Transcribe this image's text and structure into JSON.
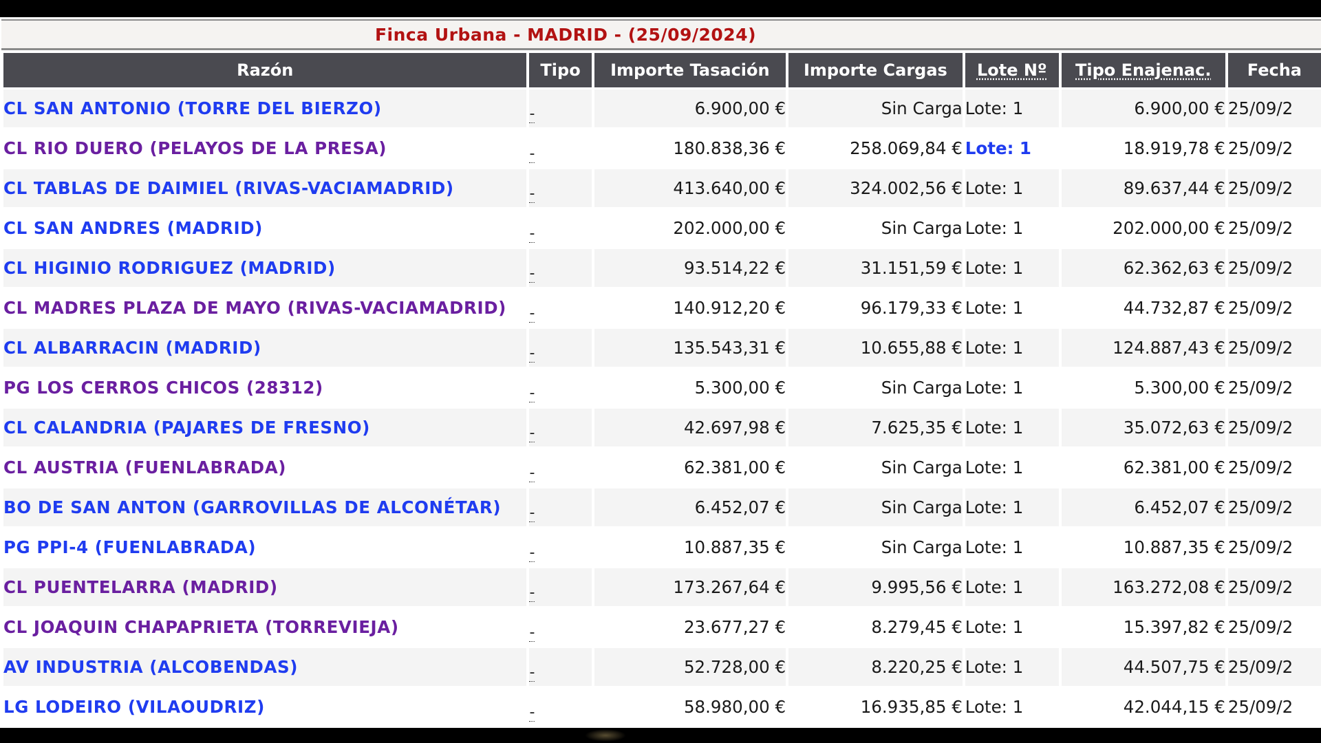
{
  "caption": "Finca Urbana - MADRID - (25/09/2024)",
  "headers": {
    "razon": "Razón",
    "tipo": "Tipo",
    "importe_tasacion": "Importe Tasación",
    "importe_cargas": "Importe Cargas",
    "lote": "Lote Nº",
    "tipo_enajenac": "Tipo Enajenac.",
    "fecha": "Fecha"
  },
  "rows": [
    {
      "razon": "CL SAN ANTONIO (TORRE DEL BIERZO)",
      "link_state": "unvisited",
      "tipo": "-",
      "tasacion": "6.900,00 €",
      "cargas": "Sin Carga",
      "lote": "Lote: 1",
      "lote_is_link": false,
      "enajenac": "6.900,00 €",
      "fecha": "25/09/2"
    },
    {
      "razon": "CL RIO DUERO (PELAYOS DE LA PRESA)",
      "link_state": "visited",
      "tipo": "-",
      "tasacion": "180.838,36 €",
      "cargas": "258.069,84 €",
      "lote": "Lote: 1",
      "lote_is_link": true,
      "enajenac": "18.919,78 €",
      "fecha": "25/09/2"
    },
    {
      "razon": "CL TABLAS DE DAIMIEL (RIVAS-VACIAMADRID)",
      "link_state": "unvisited",
      "tipo": "-",
      "tasacion": "413.640,00 €",
      "cargas": "324.002,56 €",
      "lote": "Lote: 1",
      "lote_is_link": false,
      "enajenac": "89.637,44 €",
      "fecha": "25/09/2"
    },
    {
      "razon": "CL SAN ANDRES (MADRID)",
      "link_state": "unvisited",
      "tipo": "-",
      "tasacion": "202.000,00 €",
      "cargas": "Sin Carga",
      "lote": "Lote: 1",
      "lote_is_link": false,
      "enajenac": "202.000,00 €",
      "fecha": "25/09/2"
    },
    {
      "razon": "CL HIGINIO RODRIGUEZ (MADRID)",
      "link_state": "unvisited",
      "tipo": "-",
      "tasacion": "93.514,22 €",
      "cargas": "31.151,59 €",
      "lote": "Lote: 1",
      "lote_is_link": false,
      "enajenac": "62.362,63 €",
      "fecha": "25/09/2"
    },
    {
      "razon": "CL MADRES PLAZA DE MAYO (RIVAS-VACIAMADRID)",
      "link_state": "visited",
      "tipo": "-",
      "tasacion": "140.912,20 €",
      "cargas": "96.179,33 €",
      "lote": "Lote: 1",
      "lote_is_link": false,
      "enajenac": "44.732,87 €",
      "fecha": "25/09/2"
    },
    {
      "razon": "CL ALBARRACIN (MADRID)",
      "link_state": "unvisited",
      "tipo": "-",
      "tasacion": "135.543,31 €",
      "cargas": "10.655,88 €",
      "lote": "Lote: 1",
      "lote_is_link": false,
      "enajenac": "124.887,43 €",
      "fecha": "25/09/2"
    },
    {
      "razon": "PG LOS CERROS CHICOS (28312)",
      "link_state": "visited",
      "tipo": "-",
      "tasacion": "5.300,00 €",
      "cargas": "Sin Carga",
      "lote": "Lote: 1",
      "lote_is_link": false,
      "enajenac": "5.300,00 €",
      "fecha": "25/09/2"
    },
    {
      "razon": "CL CALANDRIA (PAJARES DE FRESNO)",
      "link_state": "unvisited",
      "tipo": "-",
      "tasacion": "42.697,98 €",
      "cargas": "7.625,35 €",
      "lote": "Lote: 1",
      "lote_is_link": false,
      "enajenac": "35.072,63 €",
      "fecha": "25/09/2"
    },
    {
      "razon": "CL AUSTRIA (FUENLABRADA)",
      "link_state": "visited",
      "tipo": "-",
      "tasacion": "62.381,00 €",
      "cargas": "Sin Carga",
      "lote": "Lote: 1",
      "lote_is_link": false,
      "enajenac": "62.381,00 €",
      "fecha": "25/09/2"
    },
    {
      "razon": "BO DE SAN ANTON (GARROVILLAS DE ALCONÉTAR)",
      "link_state": "unvisited",
      "tipo": "-",
      "tasacion": "6.452,07 €",
      "cargas": "Sin Carga",
      "lote": "Lote: 1",
      "lote_is_link": false,
      "enajenac": "6.452,07 €",
      "fecha": "25/09/2"
    },
    {
      "razon": "PG PPI-4 (FUENLABRADA)",
      "link_state": "unvisited",
      "tipo": "-",
      "tasacion": "10.887,35 €",
      "cargas": "Sin Carga",
      "lote": "Lote: 1",
      "lote_is_link": false,
      "enajenac": "10.887,35 €",
      "fecha": "25/09/2"
    },
    {
      "razon": "CL PUENTELARRA (MADRID)",
      "link_state": "visited",
      "tipo": "-",
      "tasacion": "173.267,64 €",
      "cargas": "9.995,56 €",
      "lote": "Lote: 1",
      "lote_is_link": false,
      "enajenac": "163.272,08 €",
      "fecha": "25/09/2"
    },
    {
      "razon": "CL JOAQUIN CHAPAPRIETA (TORREVIEJA)",
      "link_state": "visited",
      "tipo": "-",
      "tasacion": "23.677,27 €",
      "cargas": "8.279,45 €",
      "lote": "Lote: 1",
      "lote_is_link": false,
      "enajenac": "15.397,82 €",
      "fecha": "25/09/2"
    },
    {
      "razon": "AV INDUSTRIA (ALCOBENDAS)",
      "link_state": "unvisited",
      "tipo": "-",
      "tasacion": "52.728,00 €",
      "cargas": "8.220,25 €",
      "lote": "Lote: 1",
      "lote_is_link": false,
      "enajenac": "44.507,75 €",
      "fecha": "25/09/2"
    },
    {
      "razon": "LG LODEIRO (VILAOUDRIZ)",
      "link_state": "unvisited",
      "tipo": "-",
      "tasacion": "58.980,00 €",
      "cargas": "16.935,85 €",
      "lote": "Lote: 1",
      "lote_is_link": false,
      "enajenac": "42.044,15 €",
      "fecha": "25/09/2"
    }
  ],
  "colors": {
    "caption": "#b21212",
    "header_bg": "#4a4a50",
    "link_unvisited": "#1f3cf0",
    "link_visited": "#6a1fa0",
    "row_odd": "#f4f4f4",
    "row_even": "#ffffff"
  }
}
